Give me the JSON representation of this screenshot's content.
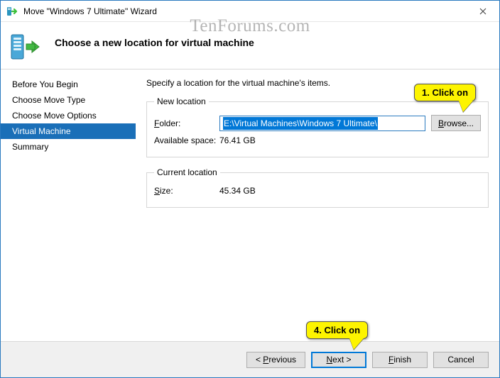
{
  "watermark": "TenForums.com",
  "window": {
    "title": "Move \"Windows 7 Ultimate\" Wizard"
  },
  "header": {
    "title": "Choose a new location for virtual machine"
  },
  "sidebar": {
    "items": [
      {
        "label": "Before You Begin"
      },
      {
        "label": "Choose Move Type"
      },
      {
        "label": "Choose Move Options"
      },
      {
        "label": "Virtual Machine"
      },
      {
        "label": "Summary"
      }
    ],
    "active_index": 3
  },
  "content": {
    "instruction": "Specify a location for the virtual machine's items.",
    "new_loc": {
      "legend": "New location",
      "folder_label": "Folder:",
      "folder_value": "E:\\Virtual Machines\\Windows 7 Ultimate\\",
      "browse_label": "Browse...",
      "avail_label": "Available space:",
      "avail_value": "76.41 GB"
    },
    "cur_loc": {
      "legend": "Current location",
      "size_label": "Size:",
      "size_value": "45.34 GB"
    }
  },
  "footer": {
    "previous": "< Previous",
    "next": "Next >",
    "finish": "Finish",
    "cancel": "Cancel"
  },
  "callouts": {
    "c1": "1. Click on",
    "c4": "4. Click on"
  }
}
